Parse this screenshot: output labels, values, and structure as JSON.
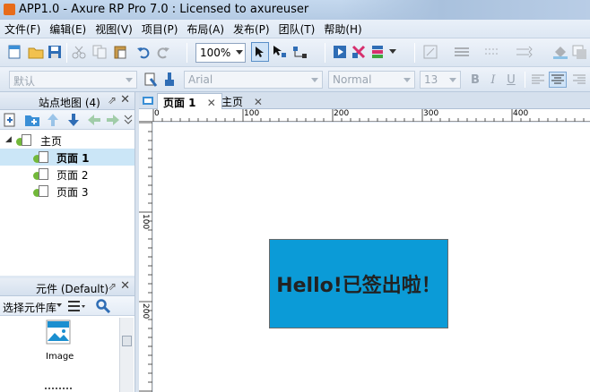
{
  "window": {
    "title": "APP1.0 - Axure RP Pro 7.0 : Licensed to axureuser"
  },
  "menu": [
    "文件(F)",
    "编辑(E)",
    "视图(V)",
    "项目(P)",
    "布局(A)",
    "发布(P)",
    "团队(T)",
    "帮助(H)"
  ],
  "toolbar": {
    "zoom": "100%"
  },
  "format": {
    "style": "默认",
    "font": "Arial",
    "weight": "Normal",
    "size": "13"
  },
  "sitemap": {
    "title": "站点地图 (4)",
    "root": "主页",
    "pages": [
      "页面 1",
      "页面 2",
      "页面 3"
    ]
  },
  "widgets": {
    "title": "元件 (Default)",
    "library_label": "选择元件库",
    "item_label": "Image"
  },
  "tabs": [
    "页面 1",
    "主页"
  ],
  "ruler": {
    "top": [
      "0",
      "100",
      "200",
      "300",
      "400"
    ],
    "left": [
      "100",
      "200"
    ]
  },
  "canvas": {
    "box_text": "Hello!已签出啦！",
    "box_color": "#0b9bd7"
  },
  "colors": {
    "accent": "#0b9bd7",
    "tree_selected": "#cbe6f7"
  }
}
